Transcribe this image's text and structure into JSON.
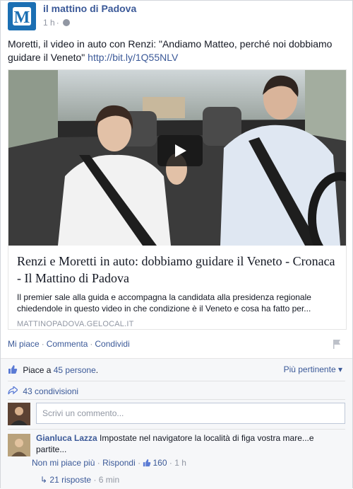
{
  "header": {
    "page_name": "il mattino di Padova",
    "time": "1 h",
    "separator": "·",
    "logo_text": "M"
  },
  "post": {
    "text": "Moretti, il video in auto con Renzi: \"Andiamo Matteo, perché noi dobbiamo guidare il Veneto\"",
    "link": "http://bit.ly/1Q55NLV"
  },
  "attachment": {
    "title": "Renzi e Moretti in auto: dobbiamo guidare il Veneto - Cronaca - Il Mattino di Padova",
    "description": "Il premier sale alla guida e accompagna la candidata alla presidenza regionale chiedendole in questo video in che condizione è il Veneto e cosa ha fatto per...",
    "domain": "MATTINOPADOVA.GELOCAL.IT"
  },
  "actions": {
    "like": "Mi piace",
    "comment": "Commenta",
    "share": "Condividi",
    "sep": "·"
  },
  "feedback": {
    "likes_prefix": "Piace a",
    "likes_count": "45 persone",
    "likes_suffix": ".",
    "relevance": "Più pertinente",
    "relevance_caret": "▾",
    "shares": "43 condivisioni",
    "comment_placeholder": "Scrivi un commento..."
  },
  "comment": {
    "author": "Gianluca Lazza",
    "text": "Impostate nel navigatore la località di figa vostra mare...e partite...",
    "unlike": "Non mi piace più",
    "reply": "Rispondi",
    "likes": "160",
    "time": "1 h",
    "sep": "·",
    "replies_arrow": "↳",
    "replies": "21 risposte",
    "replies_time": "6 min"
  },
  "colors": {
    "link": "#3b5998",
    "muted": "#9197a3",
    "logo_bg": "#1b6fb3"
  }
}
